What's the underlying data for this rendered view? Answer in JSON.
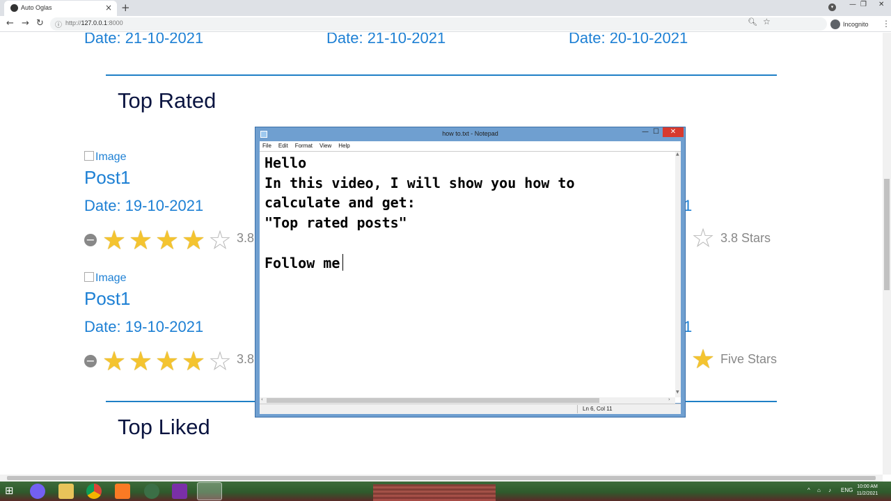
{
  "browser": {
    "tab_title": "Auto Oglas",
    "new_tab_icon": "+",
    "url_prefix": "http://",
    "url_host": "127.0.0.1",
    "url_port": ":8000",
    "profile_label": "Incognito"
  },
  "page": {
    "top_dates": [
      "Date: 21-10-2021",
      "Date: 21-10-2021",
      "Date: 20-10-2021"
    ],
    "section_top_rated": "Top Rated",
    "section_top_liked": "Top Liked",
    "image_alt": "Image",
    "posts": [
      {
        "title": "Post1",
        "date": "Date: 19-10-2021",
        "rating_label": "3.8",
        "rating": 3.8
      },
      {
        "title": "Post1",
        "date": "Date: 19-10-2021",
        "rating_label": "3.8",
        "rating": 3.8
      }
    ],
    "right_col": {
      "date_fragment_1": "1",
      "date_fragment_2": "1",
      "rating_label_1": "3.8 Stars",
      "rating_label_2": "Five Stars"
    }
  },
  "notepad": {
    "title": "how to.txt - Notepad",
    "menu": [
      "File",
      "Edit",
      "Format",
      "View",
      "Help"
    ],
    "lines": [
      "Hello",
      "In this video, I will show you how to",
      "calculate and get:",
      "\"Top rated posts\"",
      "",
      "Follow me"
    ],
    "status": "Ln 6, Col 11"
  },
  "taskbar": {
    "tray_lang": "ENG",
    "clock_time": "10:00 AM",
    "clock_date": "11/2/2021",
    "apps": [
      "windows-start",
      "viber",
      "file-explorer",
      "chrome",
      "xampp",
      "heidisql",
      "phpstorm",
      "notepad"
    ]
  }
}
